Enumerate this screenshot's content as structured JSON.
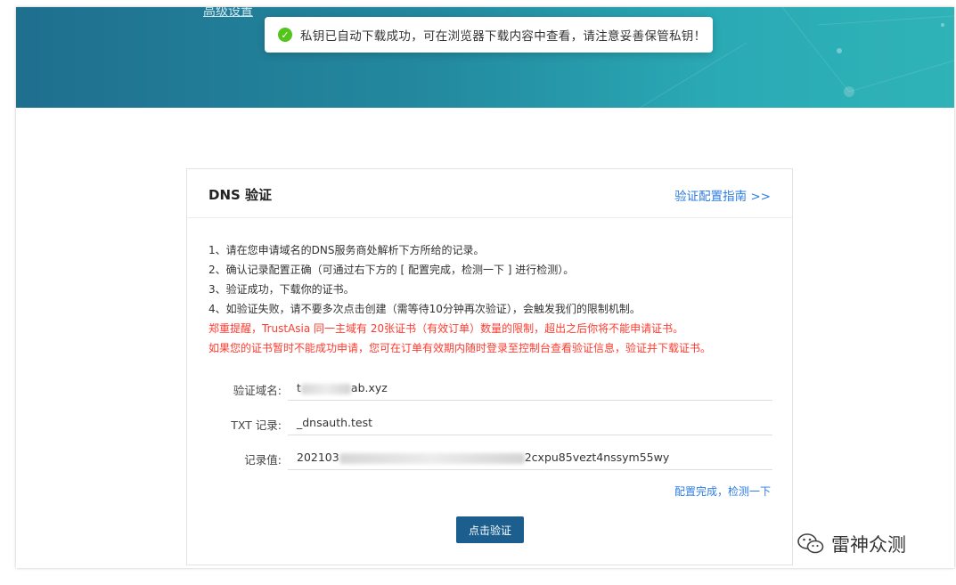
{
  "banner": {
    "advanced_link": "高级设置"
  },
  "toast": {
    "icon": "check-circle-icon",
    "message": "私钥已自动下载成功，可在浏览器下载内容中查看，请注意妥善保管私钥！"
  },
  "card": {
    "title": "DNS 验证",
    "guide_link": "验证配置指南 >>",
    "instructions": [
      "1、请在您申请域名的DNS服务商处解析下方所给的记录。",
      "2、确认记录配置正确（可通过右下方的 [ 配置完成，检测一下 ] 进行检测）。",
      "3、验证成功，下载你的证书。",
      "4、如验证失败，请不要多次点击创建（需等待10分钟再次验证），会触发我们的限制机制。"
    ],
    "warnings": [
      "郑重提醒，TrustAsia 同一主域有 20张证书（有效订单）数量的限制，超出之后你将不能申请证书。",
      "如果您的证书暂时不能成功申请，您可在订单有效期内随时登录至控制台查看验证信息，验证并下载证书。"
    ],
    "fields": {
      "domain": {
        "label": "验证域名:",
        "value_prefix": "t",
        "value_suffix": "ab.xyz"
      },
      "txt": {
        "label": "TXT 记录:",
        "value": "_dnsauth.test"
      },
      "record": {
        "label": "记录值:",
        "value_prefix": "202103",
        "value_suffix": "2cxpu85vezt4nssym55wy"
      }
    },
    "check_link": "配置完成，检测一下",
    "verify_button": "点击验证"
  },
  "watermark": {
    "icon": "wechat-icon",
    "text": "雷神众测"
  }
}
